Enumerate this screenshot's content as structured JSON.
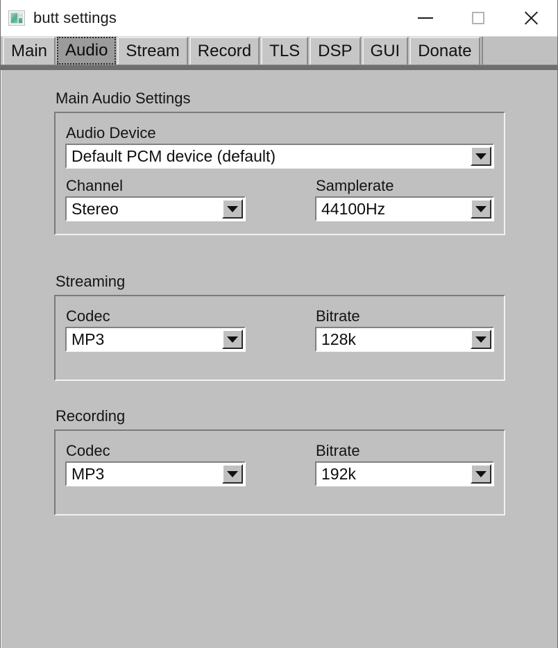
{
  "window": {
    "title": "butt settings",
    "icon": "app-window-icon",
    "controls": {
      "minimize": "minimize-icon",
      "maximize": "maximize-icon",
      "close": "close-icon"
    },
    "background_color": "#c0c0c0",
    "titlebar_color": "#ffffff"
  },
  "tabs": {
    "selected": "Audio",
    "items": [
      {
        "label": "Main",
        "selected": false
      },
      {
        "label": "Audio",
        "selected": true
      },
      {
        "label": "Stream",
        "selected": false
      },
      {
        "label": "Record",
        "selected": false
      },
      {
        "label": "TLS",
        "selected": false
      },
      {
        "label": "DSP",
        "selected": false
      },
      {
        "label": "GUI",
        "selected": false
      },
      {
        "label": "Donate",
        "selected": false
      }
    ]
  },
  "sections": {
    "main_audio": {
      "title": "Main Audio Settings",
      "audio_device": {
        "label": "Audio Device",
        "value": "Default PCM device (default)"
      },
      "channel": {
        "label": "Channel",
        "value": "Stereo"
      },
      "samplerate": {
        "label": "Samplerate",
        "value": "44100Hz"
      }
    },
    "streaming": {
      "title": "Streaming",
      "codec": {
        "label": "Codec",
        "value": "MP3"
      },
      "bitrate": {
        "label": "Bitrate",
        "value": "128k"
      }
    },
    "recording": {
      "title": "Recording",
      "codec": {
        "label": "Codec",
        "value": "MP3"
      },
      "bitrate": {
        "label": "Bitrate",
        "value": "192k"
      }
    }
  }
}
